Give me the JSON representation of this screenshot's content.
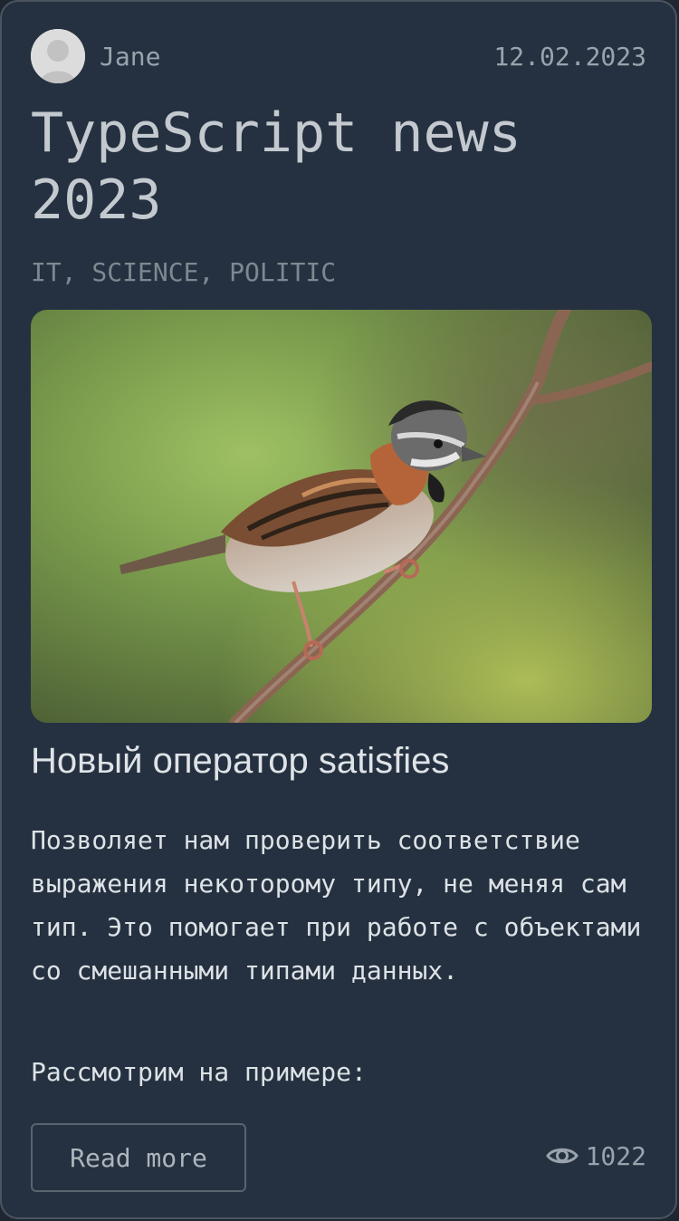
{
  "author": {
    "name": "Jane",
    "avatar_icon": "user-avatar-silhouette"
  },
  "post": {
    "date": "12.02.2023",
    "title": "TypeScript news 2023",
    "tags": "IT, SCIENCE, POLITIC",
    "image_alt": "sparrow-on-branch-photo",
    "subtitle": "Новый оператор satisfies",
    "body": "Позволяет нам проверить соответствие выражения некоторому типу, не меняя сам тип. Это помогает при работе с объектами со смешанными типами данных.",
    "body_2": "Рассмотрим на примере:"
  },
  "footer": {
    "read_more_label": "Read more",
    "views_icon": "eye-icon",
    "views_count": "1022"
  },
  "colors": {
    "card_bg": "#253140",
    "card_border": "#4c5460",
    "text_primary": "#dde2e6",
    "text_muted": "#9aa3ad"
  }
}
